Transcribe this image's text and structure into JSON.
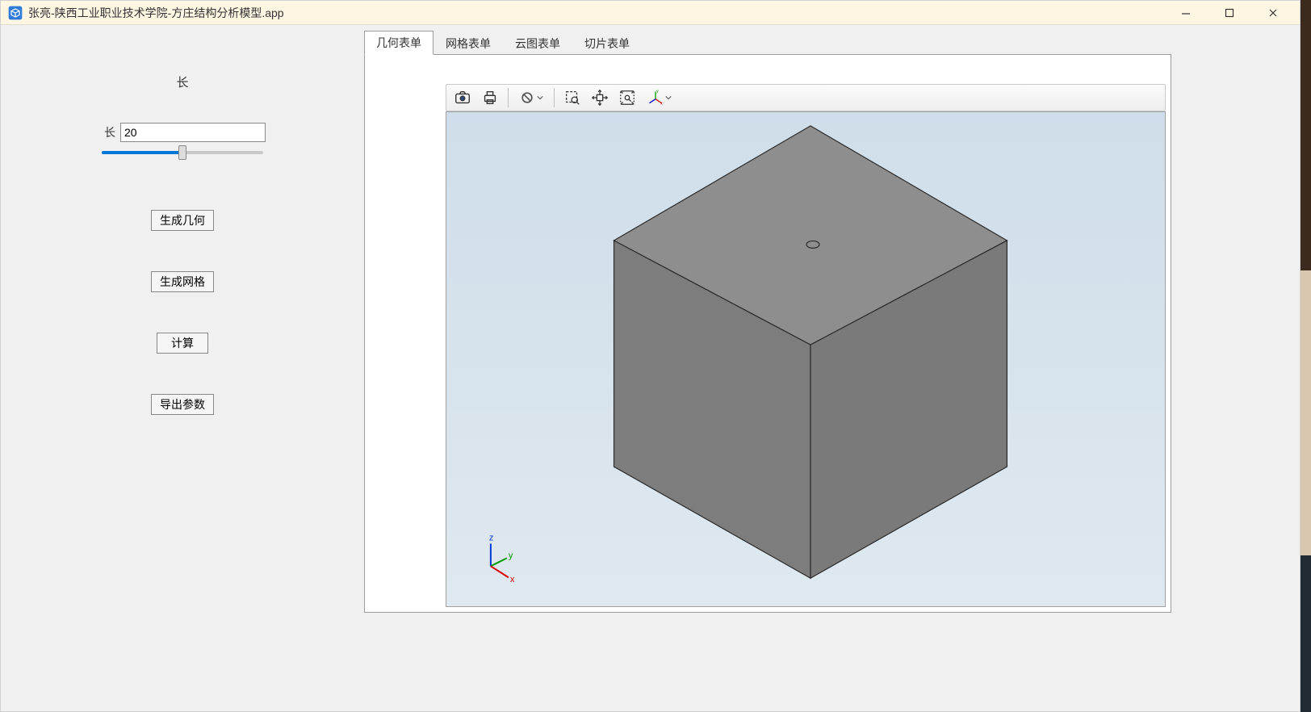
{
  "window": {
    "title": "张亮-陕西工业职业技术学院-方庄结构分析模型.app"
  },
  "sidebar": {
    "section_title": "长",
    "length_label": "长",
    "length_value": "20",
    "buttons": {
      "gen_geom": "生成几何",
      "gen_mesh": "生成网格",
      "compute": "计算",
      "export": "导出参数"
    }
  },
  "tabs": [
    {
      "id": "geom",
      "label": "几何表单",
      "active": true
    },
    {
      "id": "mesh",
      "label": "网格表单",
      "active": false
    },
    {
      "id": "cloud",
      "label": "云图表单",
      "active": false
    },
    {
      "id": "slice",
      "label": "切片表单",
      "active": false
    }
  ],
  "toolbar_icons": [
    "camera-icon",
    "print-icon",
    "reset-dropdown-icon",
    "zoom-box-icon",
    "pan-icon",
    "zoom-extents-icon",
    "axes-dropdown-icon"
  ],
  "axis_labels": {
    "x": "x",
    "y": "y",
    "z": "z"
  },
  "colors": {
    "cube_top": "#8e8e8e",
    "cube_left": "#7d7d7d",
    "cube_right": "#7a7a7a",
    "edge": "#2a2a2a",
    "bg_top": "#cfdeea",
    "bg_bottom": "#dfe8ef"
  }
}
